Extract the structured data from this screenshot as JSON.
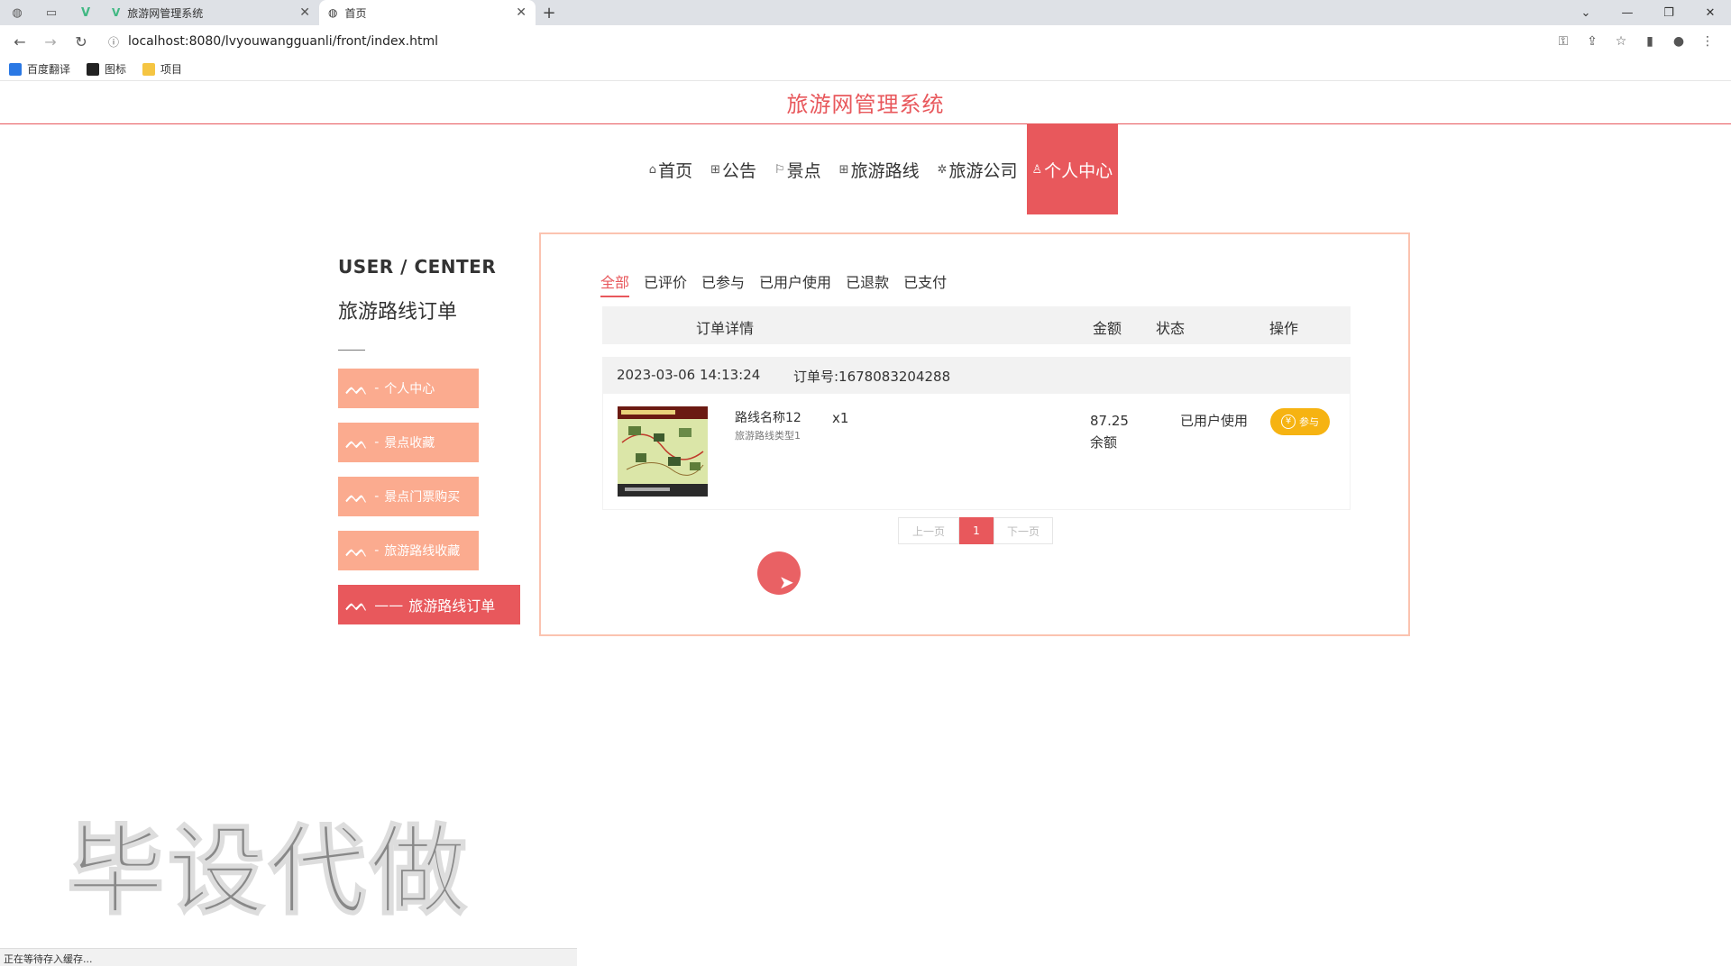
{
  "browser": {
    "tabs": [
      {
        "title": "旅游网管理系统",
        "active": false
      },
      {
        "title": "首页",
        "active": true
      }
    ],
    "new_tab": "+",
    "url": "localhost:8080/lvyouwangguanli/front/index.html",
    "bookmarks": [
      {
        "label": "百度翻译",
        "color": "#2a78e4"
      },
      {
        "label": "图标",
        "color": "#222222"
      },
      {
        "label": "项目",
        "color": "#f5c542"
      }
    ]
  },
  "site": {
    "title": "旅游网管理系统",
    "accent": "#e8585c",
    "nav": [
      {
        "icon": "⌂",
        "label": "首页",
        "active": false
      },
      {
        "icon": "⊞",
        "label": "公告",
        "active": false
      },
      {
        "icon": "⚐",
        "label": "景点",
        "active": false
      },
      {
        "icon": "⊞",
        "label": "旅游路线",
        "active": false
      },
      {
        "icon": "✲",
        "label": "旅游公司",
        "active": false
      },
      {
        "icon": "♙",
        "label": "个人中心",
        "active": true
      }
    ]
  },
  "sidebar": {
    "title": "USER / CENTER",
    "subtitle": "旅游路线订单",
    "items": [
      {
        "prefix": "-",
        "label": "个人中心",
        "active": false
      },
      {
        "prefix": "-",
        "label": "景点收藏",
        "active": false
      },
      {
        "prefix": "-",
        "label": "景点门票购买",
        "active": false
      },
      {
        "prefix": "-",
        "label": "旅游路线收藏",
        "active": false
      },
      {
        "prefix": "——",
        "label": "旅游路线订单",
        "active": true
      }
    ]
  },
  "orders": {
    "tabs": [
      {
        "label": "全部",
        "active": true
      },
      {
        "label": "已评价",
        "active": false
      },
      {
        "label": "已参与",
        "active": false
      },
      {
        "label": "已用户使用",
        "active": false
      },
      {
        "label": "已退款",
        "active": false
      },
      {
        "label": "已支付",
        "active": false
      }
    ],
    "columns": {
      "detail": "订单详情",
      "amount": "金额",
      "status": "状态",
      "action": "操作"
    },
    "order": {
      "time": "2023-03-06 14:13:24",
      "number": "订单号:1678083204288",
      "name": "路线名称12",
      "type": "旅游路线类型1",
      "qty": "x1",
      "amount": "87.25",
      "pay_method": "余额",
      "status": "已用户使用",
      "action_label": "参与",
      "action_icon": "¥"
    },
    "pager": {
      "prev": "上一页",
      "current": "1",
      "next": "下一页"
    }
  },
  "watermark": "毕设代做",
  "statusbar": "正在等待存入缓存..."
}
